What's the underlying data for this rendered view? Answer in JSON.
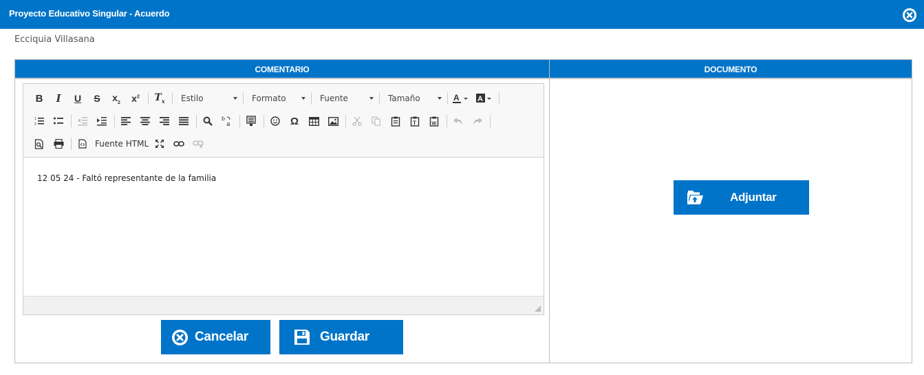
{
  "window": {
    "title": "Proyecto Educativo Singular - Acuerdo",
    "close_icon": "circle-x-icon"
  },
  "student_name": "Ecciquia Villasana",
  "comment_panel": {
    "header": "COMENTARIO",
    "editor": {
      "combos": {
        "style": "Estilo",
        "format": "Formato",
        "font": "Fuente",
        "size": "Tamaño"
      },
      "source_label": "Fuente HTML",
      "content": "12 05 24 - Faltó representante de la familia"
    },
    "buttons": {
      "cancel": "Cancelar",
      "save": "Guardar"
    }
  },
  "document_panel": {
    "header": "DOCUMENTO",
    "attach_label": "Adjuntar"
  },
  "colors": {
    "accent": "#0074c8",
    "toolbar_bg": "#f8f8f8"
  }
}
